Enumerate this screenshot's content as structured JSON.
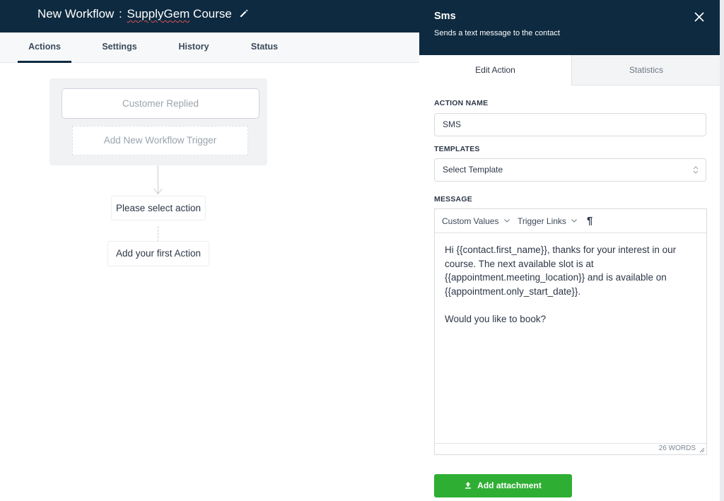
{
  "workflow": {
    "title_prefix": "New Workflow",
    "separator": " : ",
    "title_name": "SupplyGem",
    "title_suffix": " Course",
    "edit_icon": "pencil-icon"
  },
  "tabs": [
    {
      "label": "Actions",
      "active": true
    },
    {
      "label": "Settings",
      "active": false
    },
    {
      "label": "History",
      "active": false
    },
    {
      "label": "Status",
      "active": false
    }
  ],
  "canvas": {
    "trigger": "Customer Replied",
    "add_trigger": "Add New Workflow Trigger",
    "select_action": "Please select action",
    "add_first_action": "Add your first Action"
  },
  "panel": {
    "title": "Sms",
    "subtitle": "Sends a text message to the contact",
    "close_icon": "close-icon",
    "tabs": [
      {
        "label": "Edit Action",
        "active": true
      },
      {
        "label": "Statistics",
        "active": false
      }
    ],
    "action_name": {
      "label": "ACTION NAME",
      "value": "SMS"
    },
    "templates": {
      "label": "TEMPLATES",
      "selected": "Select Template"
    },
    "message": {
      "label": "MESSAGE",
      "toolbar": {
        "custom_values": "Custom Values",
        "trigger_links": "Trigger Links",
        "paragraph_icon": "¶"
      },
      "paragraphs": [
        "Hi {{contact.first_name}}, thanks for your interest in our course. The next available slot is at {{appointment.meeting_location}} and is available on {{appointment.only_start_date}}.",
        "Would you like to book?"
      ],
      "word_count": "26 WORDS"
    },
    "attach_button": "Add attachment"
  },
  "colors": {
    "header_bg": "#0e2a40",
    "accent_green": "#2fae34"
  }
}
